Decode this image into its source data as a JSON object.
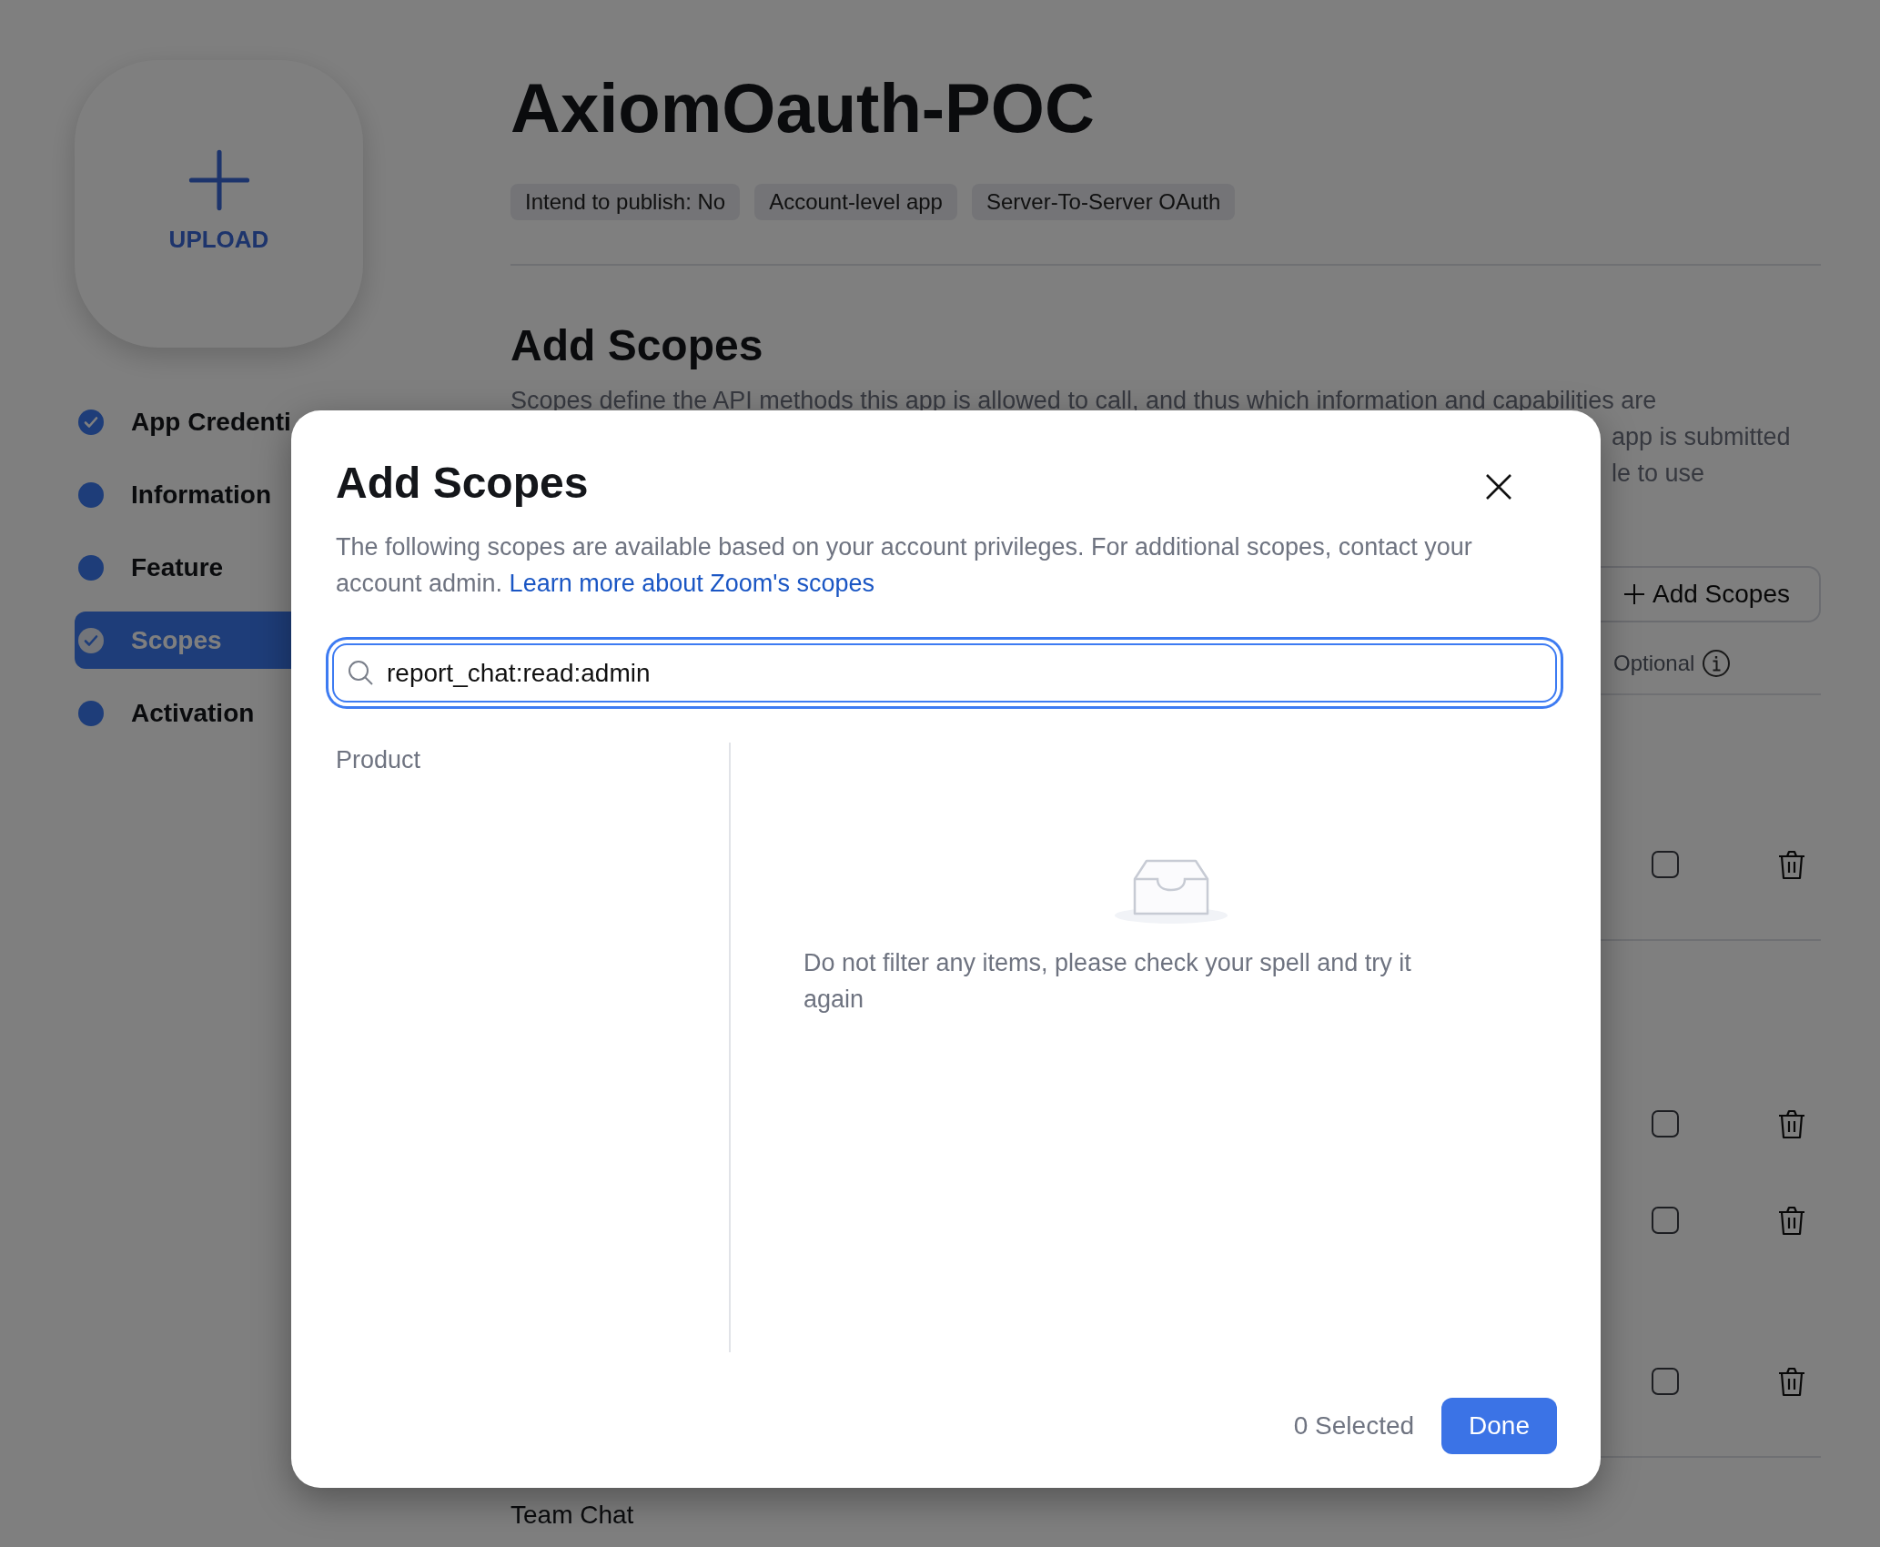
{
  "upload": {
    "label": "UPLOAD"
  },
  "sidebar": {
    "items": [
      {
        "label": "App Credenti",
        "completed": true,
        "selected": false
      },
      {
        "label": "Information",
        "completed": false,
        "selected": false
      },
      {
        "label": "Feature",
        "completed": false,
        "selected": false
      },
      {
        "label": "Scopes",
        "completed": true,
        "selected": true
      },
      {
        "label": "Activation",
        "completed": false,
        "selected": false
      }
    ]
  },
  "app": {
    "title": "AxiomOauth-POC",
    "tags": [
      "Intend to publish: No",
      "Account-level app",
      "Server-To-Server OAuth"
    ]
  },
  "section": {
    "title": "Add Scopes",
    "description_lines": [
      "Scopes define the API methods this app is allowed to call, and thus which information and capabilities are",
      "app is submitted",
      "le to use"
    ],
    "add_button": "Add Scopes",
    "column_header": "Optional"
  },
  "scope_groups": [
    {
      "rows": [
        {
          "optional": false
        }
      ]
    },
    {
      "rows": [
        {
          "optional": false
        },
        {
          "optional": false
        },
        {
          "optional": false
        }
      ]
    }
  ],
  "next_group": "Team Chat",
  "modal": {
    "title": "Add Scopes",
    "description": "The following scopes are available based on your account privileges. For additional scopes, contact your account admin.",
    "link": "Learn more about Zoom's scopes",
    "search": {
      "value": "report_chat:read:admin",
      "focused": true
    },
    "column_label": "Product",
    "empty_message": "Do not filter any items, please check your spell and try it again",
    "selected_count": "0 Selected",
    "done_button": "Done"
  }
}
